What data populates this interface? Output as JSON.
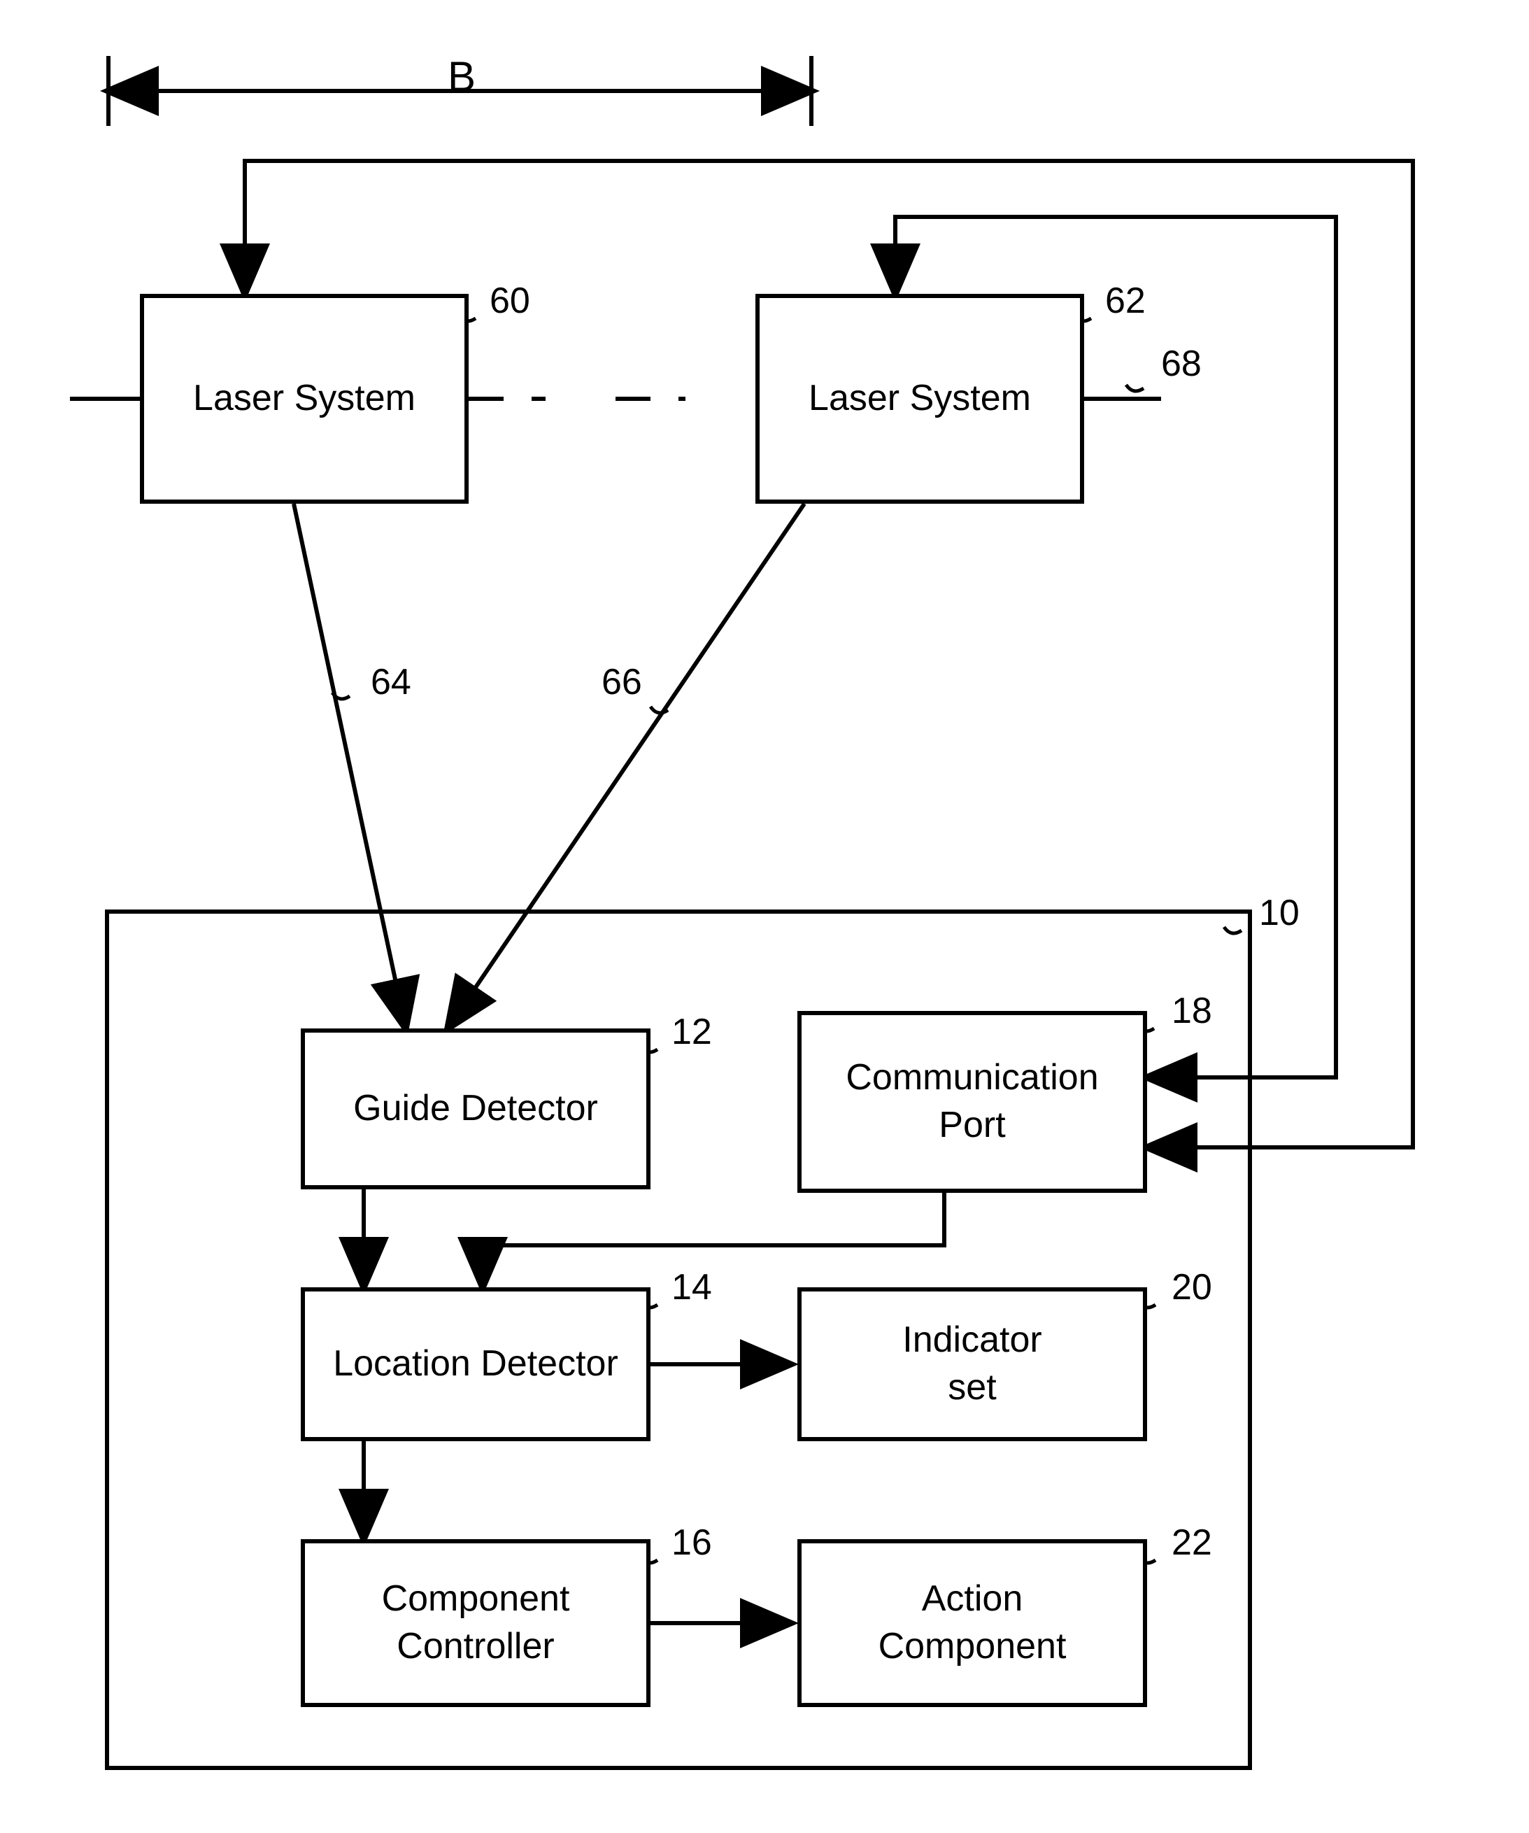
{
  "dimension_label": "B",
  "boxes": {
    "laser_system_1": "Laser System",
    "laser_system_2": "Laser System",
    "guide_detector": "Guide Detector",
    "communication_port": "Communication\nPort",
    "location_detector": "Location Detector",
    "indicator_set": "Indicator\nset",
    "component_controller": "Component\nController",
    "action_component": "Action\nComponent"
  },
  "refs": {
    "r60": "60",
    "r62": "62",
    "r68": "68",
    "r64": "64",
    "r66": "66",
    "r10": "10",
    "r12": "12",
    "r18": "18",
    "r14": "14",
    "r20": "20",
    "r16": "16",
    "r22": "22"
  }
}
